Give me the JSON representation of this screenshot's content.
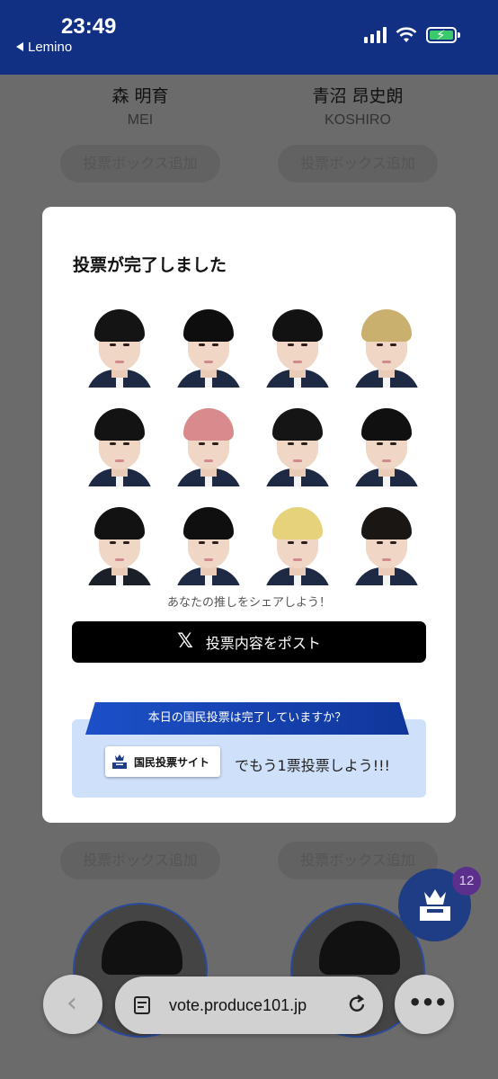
{
  "status_bar": {
    "time": "23:49",
    "back_app": "Lemino"
  },
  "background": {
    "cards_top": [
      {
        "name": "森 明育",
        "roman": "MEI",
        "button": "投票ボックス追加"
      },
      {
        "name": "青沼 昂史朗",
        "roman": "KOSHIRO",
        "button": "投票ボックス追加"
      }
    ],
    "cards_bottom": [
      {
        "button": "投票ボックス追加"
      },
      {
        "button": "投票ボックス追加"
      }
    ]
  },
  "modal": {
    "title": "投票が完了しました",
    "faces": [
      {
        "hair": "#141414",
        "jacket": "#1e2a44"
      },
      {
        "hair": "#0e0e0e",
        "jacket": "#1e2a44"
      },
      {
        "hair": "#121212",
        "jacket": "#1e2a44"
      },
      {
        "hair": "#c9b06f",
        "jacket": "#1e2a44"
      },
      {
        "hair": "#131313",
        "jacket": "#1e2a44"
      },
      {
        "hair": "#d98a8c",
        "jacket": "#1e2a44"
      },
      {
        "hair": "#151515",
        "jacket": "#1e2a44"
      },
      {
        "hair": "#101010",
        "jacket": "#1e2a44"
      },
      {
        "hair": "#121212",
        "jacket": "#1b1f28"
      },
      {
        "hair": "#0f0f0f",
        "jacket": "#1e2a44"
      },
      {
        "hair": "#e6d27a",
        "jacket": "#1e2a44"
      },
      {
        "hair": "#1a1614",
        "jacket": "#1e2a44"
      }
    ],
    "share_caption": "あなたの推しをシェアしよう！",
    "post_button": "投票内容をポスト",
    "ribbon": "本日の国民投票は完了していますか？",
    "site_badge": "国民投票サイト",
    "vote_more": "でもう1票投票しよう!!!"
  },
  "fab": {
    "count": "12",
    "icon": "crown-ballot-box-icon"
  },
  "browser": {
    "url": "vote.produce101.jp"
  }
}
